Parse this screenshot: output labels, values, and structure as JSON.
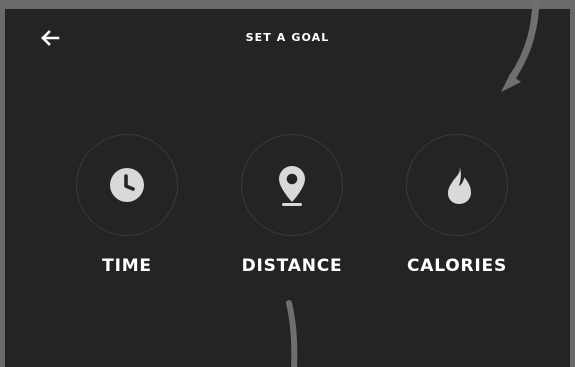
{
  "header": {
    "title": "SET A GOAL",
    "back_icon": "arrow-left-icon"
  },
  "goals": [
    {
      "label": "TIME",
      "icon": "clock-icon"
    },
    {
      "label": "DISTANCE",
      "icon": "location-pin-icon"
    },
    {
      "label": "CALORIES",
      "icon": "flame-icon"
    }
  ],
  "colors": {
    "background": "#242424",
    "frame": "#6a6a6a",
    "text": "#ffffff",
    "icon": "#d9d9d9",
    "ring": "#3a3a3a"
  }
}
